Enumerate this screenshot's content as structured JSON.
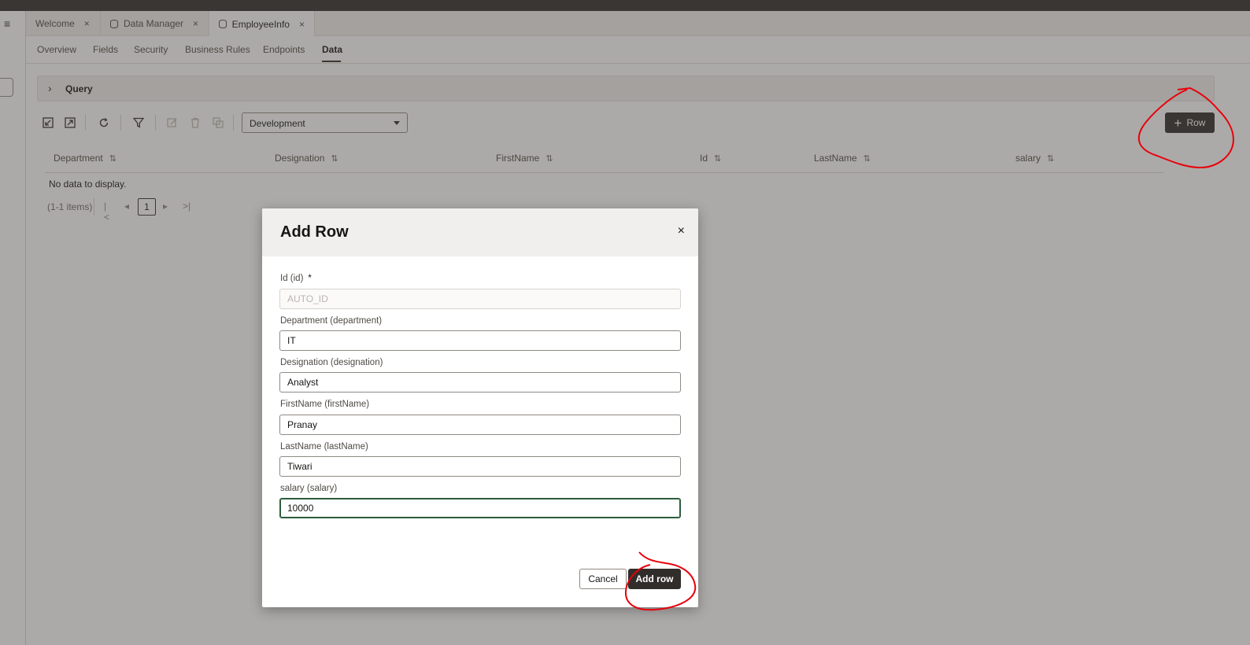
{
  "tabs": [
    {
      "label": "Welcome",
      "close": "×",
      "icon": "none"
    },
    {
      "label": "Data Manager",
      "close": "×",
      "icon": "database-icon"
    },
    {
      "label": "EmployeeInfo",
      "close": "×",
      "icon": "database-icon"
    }
  ],
  "menu_icon": "≡",
  "subnav": [
    "Overview",
    "Fields",
    "Security",
    "Business Rules",
    "Endpoints",
    "Data"
  ],
  "query": {
    "label": "Query",
    "chevron": "›"
  },
  "toolbar": {
    "icons": [
      "import-icon",
      "export-icon",
      "refresh-icon",
      "filter-icon",
      "edit-icon",
      "delete-icon",
      "duplicate-icon"
    ],
    "environment": "Development",
    "add_row_label": "Row",
    "plus": "+"
  },
  "grid": {
    "columns": [
      "Department",
      "Designation",
      "FirstName",
      "Id",
      "LastName",
      "salary"
    ],
    "sort_glyph": "⇅",
    "empty_message": "No data to display.",
    "pager": {
      "info": "(1-1 items)",
      "page": "1",
      "first": "|<",
      "prev": "◂",
      "next": "▸",
      "last": ">|"
    }
  },
  "dialog": {
    "title": "Add Row",
    "close": "×",
    "fields": [
      {
        "label": "Id (id)",
        "required_mark": "*",
        "value": "",
        "placeholder": "AUTO_ID"
      },
      {
        "label": "Department (department)",
        "value": "IT"
      },
      {
        "label": "Designation (designation)",
        "value": "Analyst"
      },
      {
        "label": "FirstName (firstName)",
        "value": "Pranay"
      },
      {
        "label": "LastName (lastName)",
        "value": "Tiwari"
      },
      {
        "label": "salary (salary)",
        "value": "10000"
      }
    ],
    "cancel_label": "Cancel",
    "submit_label": "Add row"
  },
  "colors": {
    "accent_dark": "#312d2a",
    "annotation_red": "#e8000b",
    "focus_green": "#2e5c3c"
  }
}
